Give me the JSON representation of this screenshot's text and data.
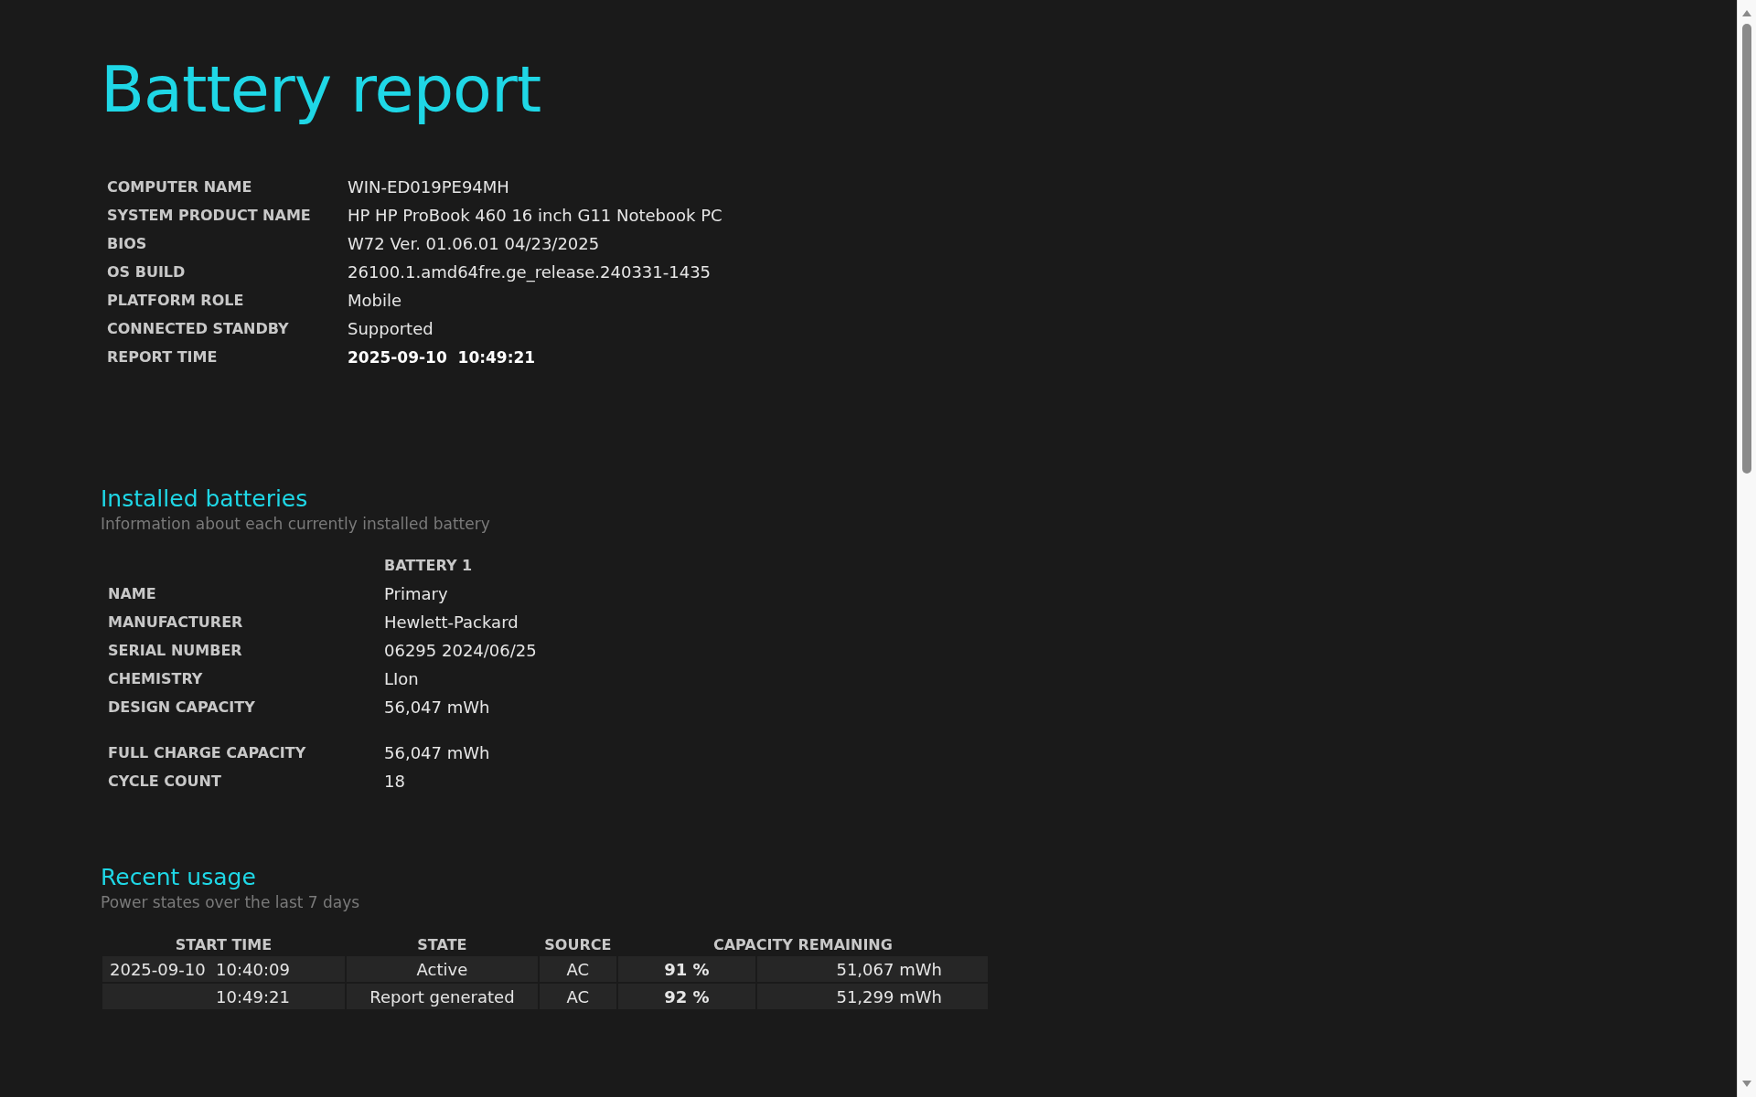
{
  "title": "Battery report",
  "system_info": [
    {
      "label": "COMPUTER NAME",
      "value": "WIN-ED019PE94MH",
      "kind": "plain"
    },
    {
      "label": "SYSTEM PRODUCT NAME",
      "value": "HP HP ProBook 460 16 inch G11 Notebook PC",
      "kind": "plain"
    },
    {
      "label": "BIOS",
      "value": "W72 Ver. 01.06.01 04/23/2025",
      "kind": "plain"
    },
    {
      "label": "OS BUILD",
      "value": "26100.1.amd64fre.ge_release.240331-1435",
      "kind": "plain"
    },
    {
      "label": "PLATFORM ROLE",
      "value": "Mobile",
      "kind": "plain"
    },
    {
      "label": "CONNECTED STANDBY",
      "value": "Supported",
      "kind": "plain"
    },
    {
      "label": "REPORT TIME",
      "value": "2025-09-10  10:49:21",
      "kind": "time"
    }
  ],
  "installed_batteries": {
    "heading": "Installed batteries",
    "subtitle": "Information about each currently installed battery",
    "column": "BATTERY 1",
    "groups": [
      [
        {
          "label": "NAME",
          "value": "Primary"
        },
        {
          "label": "MANUFACTURER",
          "value": "Hewlett-Packard"
        },
        {
          "label": "SERIAL NUMBER",
          "value": "06295 2024/06/25"
        },
        {
          "label": "CHEMISTRY",
          "value": "LIon"
        },
        {
          "label": "DESIGN CAPACITY",
          "value": "56,047 mWh"
        }
      ],
      [
        {
          "label": "FULL CHARGE CAPACITY",
          "value": "56,047 mWh"
        },
        {
          "label": "CYCLE COUNT",
          "value": "18"
        }
      ]
    ]
  },
  "recent_usage": {
    "heading": "Recent usage",
    "subtitle": "Power states over the last 7 days",
    "columns": [
      "START TIME",
      "STATE",
      "SOURCE",
      "CAPACITY REMAINING"
    ],
    "rows": [
      {
        "start_time": "2025-09-10  10:40:09",
        "state": "Active",
        "source": "AC",
        "percent": "91 %",
        "energy": "51,067 mWh"
      },
      {
        "start_time": "10:49:21",
        "state": "Report generated",
        "source": "AC",
        "percent": "92 %",
        "energy": "51,299 mWh"
      }
    ]
  }
}
